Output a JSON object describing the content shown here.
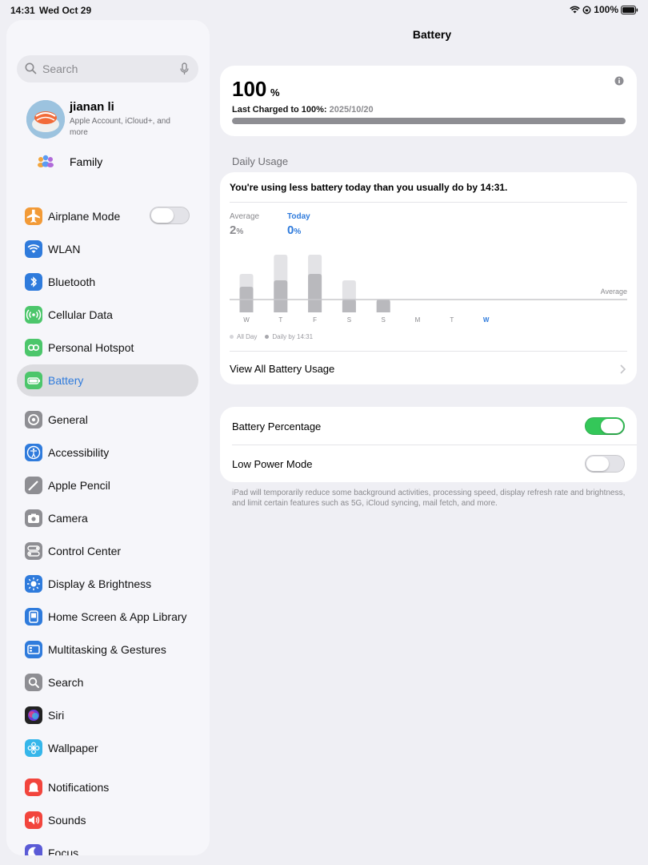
{
  "status": {
    "time": "14:31",
    "date": "Wed Oct 29",
    "battery": "100%"
  },
  "sidebar": {
    "search_placeholder": "Search",
    "profile": {
      "name": "jianan li",
      "subtitle": "Apple Account, iCloud+, and more"
    },
    "family_label": "Family",
    "items": [
      {
        "label": "Airplane Mode",
        "icon": "airplane-icon",
        "color": "#f29a37"
      },
      {
        "label": "WLAN",
        "icon": "wifi-icon",
        "color": "#2f7bdc"
      },
      {
        "label": "Bluetooth",
        "icon": "bluetooth-icon",
        "color": "#2f7bdc"
      },
      {
        "label": "Cellular Data",
        "icon": "antenna-icon",
        "color": "#4cc66b"
      },
      {
        "label": "Personal Hotspot",
        "icon": "hotspot-icon",
        "color": "#4cc66b"
      },
      {
        "label": "Battery",
        "icon": "battery-icon",
        "color": "#4cc66b"
      },
      {
        "label": "General",
        "icon": "gear-icon",
        "color": "#8e8e93"
      },
      {
        "label": "Accessibility",
        "icon": "accessibility-icon",
        "color": "#2f7bdc"
      },
      {
        "label": "Apple Pencil",
        "icon": "pencil-icon",
        "color": "#8e8e93"
      },
      {
        "label": "Camera",
        "icon": "camera-icon",
        "color": "#8e8e93"
      },
      {
        "label": "Control Center",
        "icon": "control-center-icon",
        "color": "#8e8e93"
      },
      {
        "label": "Display & Brightness",
        "icon": "sun-icon",
        "color": "#2f7bdc"
      },
      {
        "label": "Home Screen & App Library",
        "icon": "home-screen-icon",
        "color": "#2f7bdc"
      },
      {
        "label": "Multitasking & Gestures",
        "icon": "multitasking-icon",
        "color": "#2f7bdc"
      },
      {
        "label": "Search",
        "icon": "search-icon",
        "color": "#8e8e93"
      },
      {
        "label": "Siri",
        "icon": "siri-icon",
        "color": "#222222"
      },
      {
        "label": "Wallpaper",
        "icon": "flower-icon",
        "color": "#35b6ea"
      },
      {
        "label": "Notifications",
        "icon": "bell-icon",
        "color": "#f2453d"
      },
      {
        "label": "Sounds",
        "icon": "speaker-icon",
        "color": "#f2453d"
      },
      {
        "label": "Focus",
        "icon": "moon-icon",
        "color": "#5b5bd6"
      }
    ]
  },
  "main": {
    "title": "Battery",
    "level": {
      "value": "100",
      "unit": "%",
      "fill_fraction": 1.0
    },
    "last_charged_label": "Last Charged to 100%:",
    "last_charged_date": "2025/10/20",
    "daily_usage_header": "Daily Usage",
    "usage_message": "You're using less battery today than you usually do by 14:31.",
    "average_label": "Average",
    "average_value": "2",
    "today_label": "Today",
    "today_value": "0",
    "percent_unit": "%",
    "average_line_label": "Average",
    "legend_all_day": "All Day",
    "legend_daily_by": "Daily by 14:31",
    "view_all_label": "View All Battery Usage",
    "battery_percentage_label": "Battery Percentage",
    "battery_percentage_on": true,
    "low_power_label": "Low Power Mode",
    "low_power_on": false,
    "low_power_note": "iPad will temporarily reduce some background activities, processing speed, display refresh rate and brightness, and limit certain features such as 5G, iCloud syncing, mail fetch, and more."
  },
  "chart_data": {
    "type": "bar",
    "categories": [
      "W",
      "T",
      "F",
      "S",
      "S",
      "M",
      "T",
      "W"
    ],
    "series": [
      {
        "name": "All Day",
        "values": [
          3,
          4.5,
          4.5,
          2.5,
          1,
          0,
          0,
          0
        ]
      },
      {
        "name": "Daily by 14:31",
        "values": [
          2,
          2.5,
          3,
          1,
          1,
          0,
          0,
          0
        ]
      }
    ],
    "average": 1.0,
    "ylim": [
      0,
      5
    ],
    "highlight_category_index": 7,
    "colors": {
      "all_day": "#e3e3e6",
      "daily_by": "#b9b9bd",
      "today": "#2f7bdc"
    }
  }
}
